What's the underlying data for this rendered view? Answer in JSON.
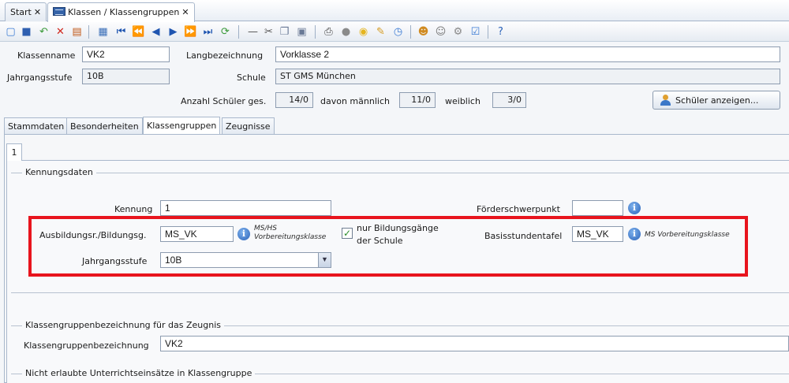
{
  "tabs": [
    {
      "label": "Start",
      "close": "✕"
    },
    {
      "label": "Klassen / Klassengruppen",
      "close": "✕"
    }
  ],
  "toolbar": {
    "icons": [
      "new-icon",
      "save-icon",
      "undo-icon",
      "delete-icon",
      "form-icon",
      "table-icon",
      "first-icon",
      "prev-page-icon",
      "prev-icon",
      "next-icon",
      "next-page-icon",
      "last-icon",
      "refresh-icon",
      "minus-icon",
      "cut-icon",
      "copy-icon",
      "paste-icon",
      "print-icon",
      "preview-icon",
      "bulb-icon",
      "broom-icon",
      "clock-icon",
      "users-icon",
      "user-icon",
      "settings-icon",
      "edit-icon",
      "help-icon"
    ]
  },
  "header": {
    "klassenname_label": "Klassenname",
    "klassenname_value": "VK2",
    "langbezeichnung_label": "Langbezeichnung",
    "langbezeichnung_value": "Vorklasse 2",
    "jahrgangsstufe_label": "Jahrgangsstufe",
    "jahrgangsstufe_value": "10B",
    "schule_label": "Schule",
    "schule_value": "ST GMS München",
    "anzahl_label": "Anzahl Schüler ges.",
    "anzahl_value": "14/0",
    "maennlich_label": "davon männlich",
    "maennlich_value": "11/0",
    "weiblich_label": "weiblich",
    "weiblich_value": "3/0",
    "show_students_button": "Schüler anzeigen..."
  },
  "sub_tabs": [
    "Stammdaten",
    "Besonderheiten",
    "Klassengruppen",
    "Zeugnisse"
  ],
  "inner_tab": "1",
  "kennungsdaten": {
    "title": "Kennungsdaten",
    "kennung_label": "Kennung",
    "kennung_value": "1",
    "foerder_label": "Förderschwerpunkt",
    "foerder_value": "",
    "ausbildung_label": "Ausbildungsr./Bildungsg.",
    "ausbildung_value": "MS_VK",
    "ausbildung_hint_line1": "MS/HS",
    "ausbildung_hint_line2": "Vorbereitungsklasse",
    "only_school_line1": "nur Bildungsgänge",
    "only_school_line2": "der Schule",
    "basis_label": "Basisstundentafel",
    "basis_value": "MS_VK",
    "basis_hint": "MS Vorbereitungsklasse",
    "jahrgang_label": "Jahrgangsstufe",
    "jahrgang_value": "10B"
  },
  "zeugnis": {
    "title": "Klassengruppenbezeichnung für das Zeugnis",
    "label": "Klassengruppenbezeichnung",
    "value": "VK2"
  },
  "unterricht": {
    "title": "Nicht erlaubte Unterrichtseinsätze in Klassengruppe"
  },
  "colors": {
    "highlight": "#e8141d",
    "accent": "#2a62b8"
  }
}
